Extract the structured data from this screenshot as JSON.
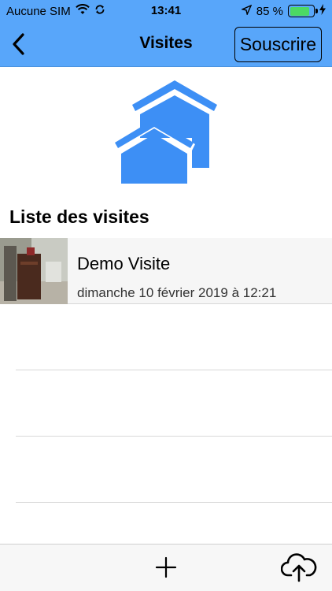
{
  "status_bar": {
    "carrier": "Aucune SIM",
    "time": "13:41",
    "battery": "85 %",
    "battery_level": 0.85
  },
  "nav": {
    "title": "Visites",
    "subscribe_label": "Souscrire",
    "back_icon": "chevron-left-icon"
  },
  "logo_icon": "houses-icon",
  "section_title": "Liste des visites",
  "visits": [
    {
      "title": "Demo Visite",
      "date": "dimanche 10 février 2019 à 12:21"
    }
  ],
  "toolbar": {
    "add_icon": "plus-icon",
    "upload_icon": "cloud-upload-icon"
  },
  "colors": {
    "accent": "#58a6fa",
    "icon_blue": "#3d8ff5",
    "battery_green": "#4cd964"
  }
}
